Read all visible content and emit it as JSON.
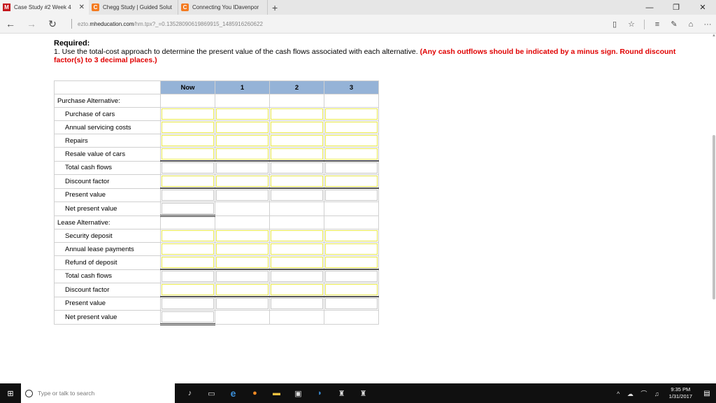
{
  "tabs": [
    {
      "icon": "M",
      "title": "Case Study #2 Week 4",
      "close": "✕"
    },
    {
      "icon": "C",
      "title": "Chegg Study | Guided Solut"
    },
    {
      "icon": "C",
      "title": "Connecting You IDavenpor"
    }
  ],
  "new_tab": "+",
  "url": {
    "prefix": "ezto.",
    "domain": "mheducation.com",
    "path": "/hm.tpx?_=0.13528090619869915_1485916260622"
  },
  "required": {
    "heading": "Required:",
    "text": "1. Use the total-cost approach to determine the present value of the cash flows associated with each alternative.",
    "instruction": "(Any cash outflows should be indicated by a minus sign. Round discount factor(s) to 3 decimal places.)"
  },
  "table": {
    "headers": [
      "Now",
      "1",
      "2",
      "3"
    ],
    "rows": [
      {
        "label": "Purchase Alternative:"
      },
      {
        "label": "Purchase of cars"
      },
      {
        "label": "Annual servicing costs"
      },
      {
        "label": "Repairs"
      },
      {
        "label": "Resale value of cars"
      },
      {
        "label": "Total cash flows"
      },
      {
        "label": "Discount factor"
      },
      {
        "label": "Present value"
      },
      {
        "label": "Net present value"
      },
      {
        "label": "Lease Alternative:"
      },
      {
        "label": "Security deposit"
      },
      {
        "label": "Annual lease payments"
      },
      {
        "label": "Refund of deposit"
      },
      {
        "label": "Total cash flows"
      },
      {
        "label": "Discount factor"
      },
      {
        "label": "Present value"
      },
      {
        "label": "Net present value"
      }
    ]
  },
  "taskbar": {
    "search_placeholder": "Type or talk to search",
    "time": "9:35 PM",
    "date": "1/31/2017"
  }
}
